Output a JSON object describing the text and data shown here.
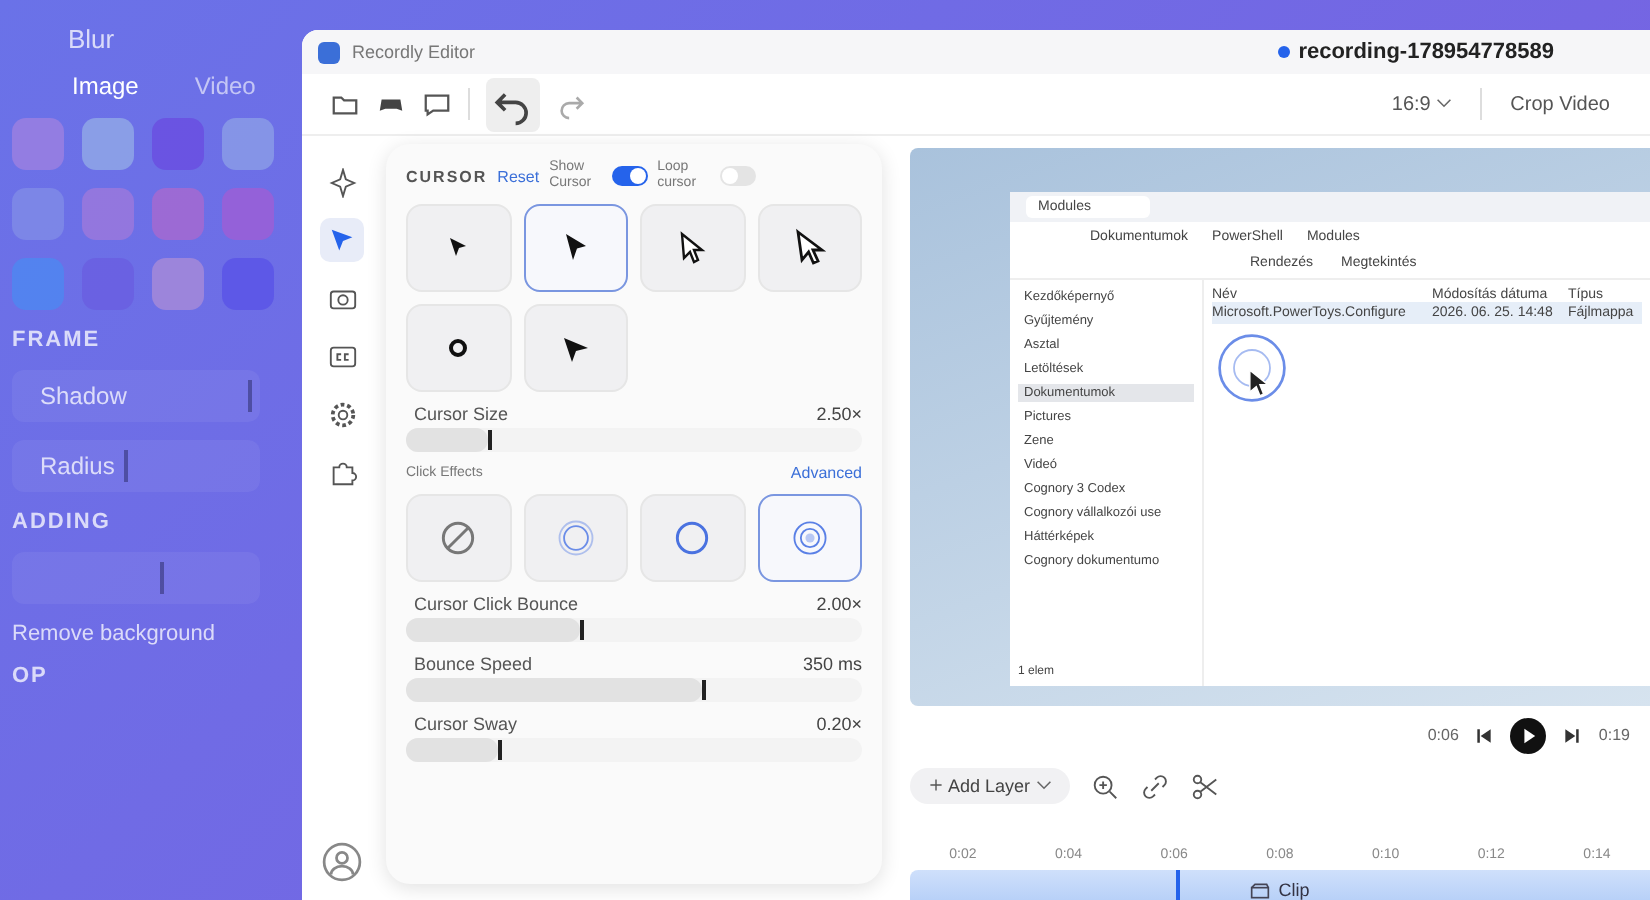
{
  "background_panel": {
    "title": "Blur",
    "tabs": [
      {
        "label": "Image",
        "selected": true
      },
      {
        "label": "Video",
        "selected": false
      }
    ],
    "swatches": [
      {
        "color": "#9a7fe0"
      },
      {
        "color": "#8fa6e6"
      },
      {
        "color": "#6a4fe0"
      },
      {
        "color": "#8a9be6"
      },
      {
        "color": "#7f8ae6"
      },
      {
        "color": "#9a78dc"
      },
      {
        "color": "#a56ad0"
      },
      {
        "color": "#9b5fd6"
      },
      {
        "color": "#4f86f0"
      },
      {
        "color": "#6a5fe0"
      },
      {
        "color": "#a48ad8"
      },
      {
        "color": "#5a55e6"
      }
    ],
    "items": [
      {
        "kind": "heading",
        "label": "FRAME"
      },
      {
        "kind": "slider",
        "label": "Shadow",
        "level": 0.95
      },
      {
        "kind": "slider",
        "label": "Radius",
        "level": 0.45
      },
      {
        "kind": "heading",
        "label": "ADDING"
      },
      {
        "kind": "slider",
        "level": 0.6
      },
      {
        "kind": "text",
        "label": "Remove background"
      },
      {
        "kind": "heading",
        "label": "OP"
      }
    ]
  },
  "window": {
    "title": "Recordly Editor",
    "file": "recording-178954778589",
    "aspect": "16:9",
    "crop": "Crop Video"
  },
  "rail": [
    {
      "kind": "sparkle",
      "selected": false
    },
    {
      "kind": "cursor",
      "selected": true
    },
    {
      "kind": "camera",
      "selected": false
    },
    {
      "kind": "cc",
      "selected": false
    },
    {
      "kind": "gear",
      "selected": false
    },
    {
      "kind": "puzzle",
      "selected": false
    }
  ],
  "cursor_panel": {
    "title": "CURSOR",
    "reset": "Reset",
    "show_cursor": {
      "label": "Show Cursor",
      "on": true
    },
    "loop_cursor": {
      "label": "Loop cursor",
      "on": false
    },
    "styles": [
      {
        "kind": "arrow-small",
        "selected": false
      },
      {
        "kind": "arrow",
        "selected": true
      },
      {
        "kind": "outline",
        "selected": false
      },
      {
        "kind": "outline-large",
        "selected": false
      },
      {
        "kind": "dot",
        "selected": false
      },
      {
        "kind": "pointer",
        "selected": false
      }
    ],
    "size": {
      "label": "Cursor Size",
      "reading": "2.50×",
      "level": 0.18
    },
    "click_effects_label": "Click Effects",
    "advanced": "Advanced",
    "effects": [
      {
        "kind": "none",
        "selected": false
      },
      {
        "kind": "ripple",
        "selected": false
      },
      {
        "kind": "ring",
        "selected": false
      },
      {
        "kind": "double-ring",
        "selected": true
      }
    ],
    "sliders": [
      {
        "label": "Cursor Click Bounce",
        "reading": "2.00×",
        "level": 0.38
      },
      {
        "label": "Bounce Speed",
        "reading": "350 ms",
        "level": 0.65
      },
      {
        "label": "Cursor Sway",
        "reading": "0.20×",
        "level": 0.2
      }
    ]
  },
  "explorer": {
    "tab": "Modules",
    "breadcrumb": [
      "Dokumentumok",
      "PowerShell",
      "Modules"
    ],
    "sort": "Rendezés",
    "view": "Megtekintés",
    "columns": [
      "Név",
      "Módosítás dátuma",
      "Típus"
    ],
    "rows": [
      {
        "name": "Microsoft.PowerToys.Configure",
        "date": "2026. 06. 25. 14:48",
        "type": "Fájlmappa",
        "selected": true
      }
    ],
    "sidebar": [
      {
        "label": "Kezdőképernyő",
        "selected": false
      },
      {
        "label": "Gyűjtemény",
        "selected": false
      },
      {
        "label": "Asztal",
        "selected": false
      },
      {
        "label": "Letöltések",
        "selected": false
      },
      {
        "label": "Dokumentumok",
        "selected": true
      },
      {
        "label": "Pictures",
        "selected": false
      },
      {
        "label": "Zene",
        "selected": false
      },
      {
        "label": "Videó",
        "selected": false
      },
      {
        "label": "Cognory 3 Codex",
        "selected": false
      },
      {
        "label": "Cognory vállalkozói use",
        "selected": false
      },
      {
        "label": "Háttérképek",
        "selected": false
      },
      {
        "label": "Cognory dokumentumo",
        "selected": false
      }
    ],
    "status": "1 elem"
  },
  "player": {
    "current": "0:06",
    "total": "0:19"
  },
  "timeline": {
    "add_layer": "Add Layer",
    "ticks": [
      "0:02",
      "0:04",
      "0:06",
      "0:08",
      "0:10",
      "0:12",
      "0:14"
    ],
    "playhead": {
      "level": 0.36
    },
    "clip": "Clip"
  }
}
